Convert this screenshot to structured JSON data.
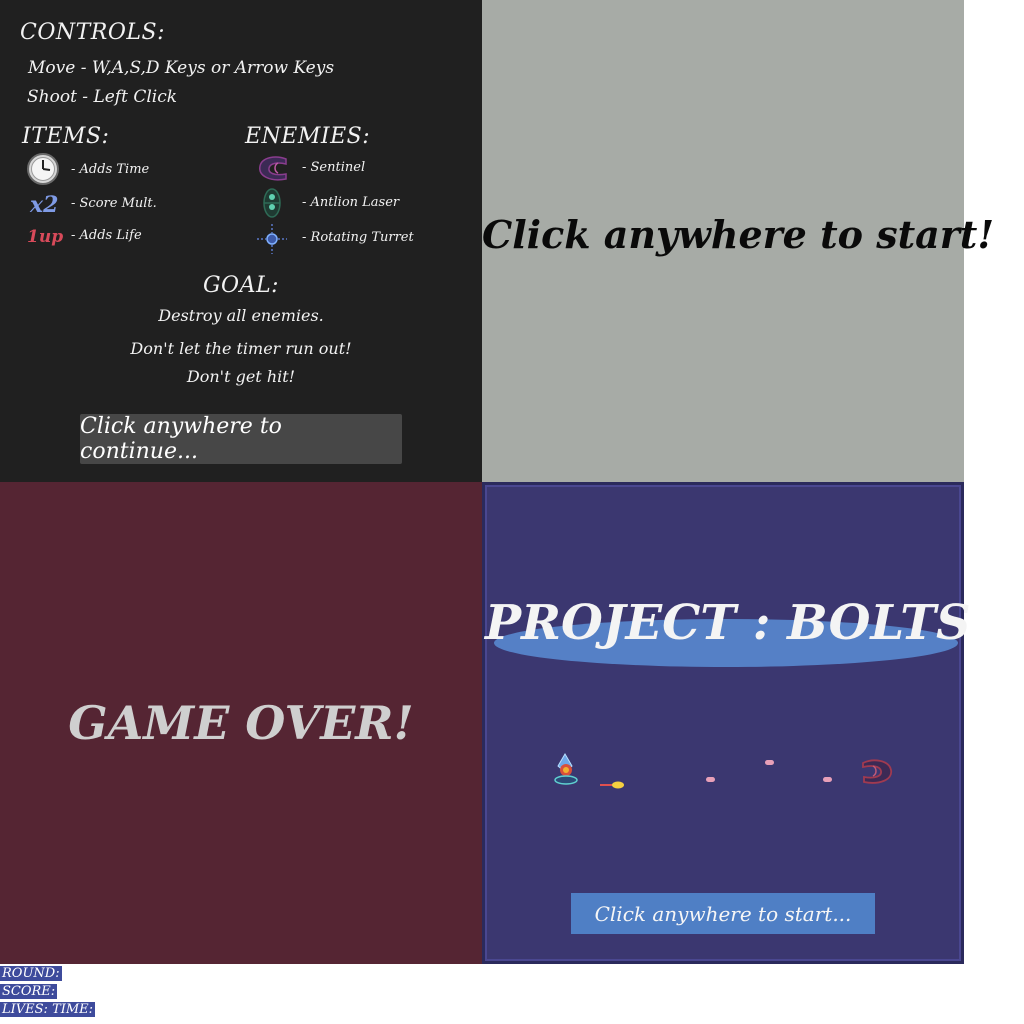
{
  "instructions": {
    "controls_title": "CONTROLS:",
    "controls": [
      "Move - W,A,S,D Keys or Arrow Keys",
      "Shoot - Left Click"
    ],
    "items_title": "ITEMS:",
    "items": [
      {
        "icon": "clock-icon",
        "label": "- Adds Time",
        "glyph": ""
      },
      {
        "icon": "x2-icon",
        "label": "- Score Mult.",
        "glyph": "x2"
      },
      {
        "icon": "1up-icon",
        "label": "- Adds Life",
        "glyph": "1up"
      }
    ],
    "enemies_title": "ENEMIES:",
    "enemies": [
      {
        "icon": "sentinel-icon",
        "label": "- Sentinel"
      },
      {
        "icon": "antlion-laser-icon",
        "label": "- Antlion Laser"
      },
      {
        "icon": "rotating-turret-icon",
        "label": "- Rotating Turret"
      }
    ],
    "goal_title": "GOAL:",
    "goals": [
      "Destroy all enemies.",
      "Don't let the timer run out!",
      "Don't get hit!"
    ],
    "continue_label": "Click anywhere to continue..."
  },
  "start_screen": {
    "label": "Click anywhere to start!"
  },
  "game_over": {
    "label": "GAME OVER!"
  },
  "title_screen": {
    "title": "PROJECT : BOLTS",
    "start_label": "Click anywhere to start..."
  },
  "hud": {
    "round_label": "ROUND:",
    "score_label": "SCORE:",
    "lives_time_label": "LIVES: TIME:"
  },
  "colors": {
    "instructions_bg": "#202020",
    "start_bg": "#a7aba6",
    "game_over_bg": "#552533",
    "title_bg": "#3b3770",
    "accent_blue": "#5580c6",
    "hud_bg": "#3e4b9c"
  }
}
